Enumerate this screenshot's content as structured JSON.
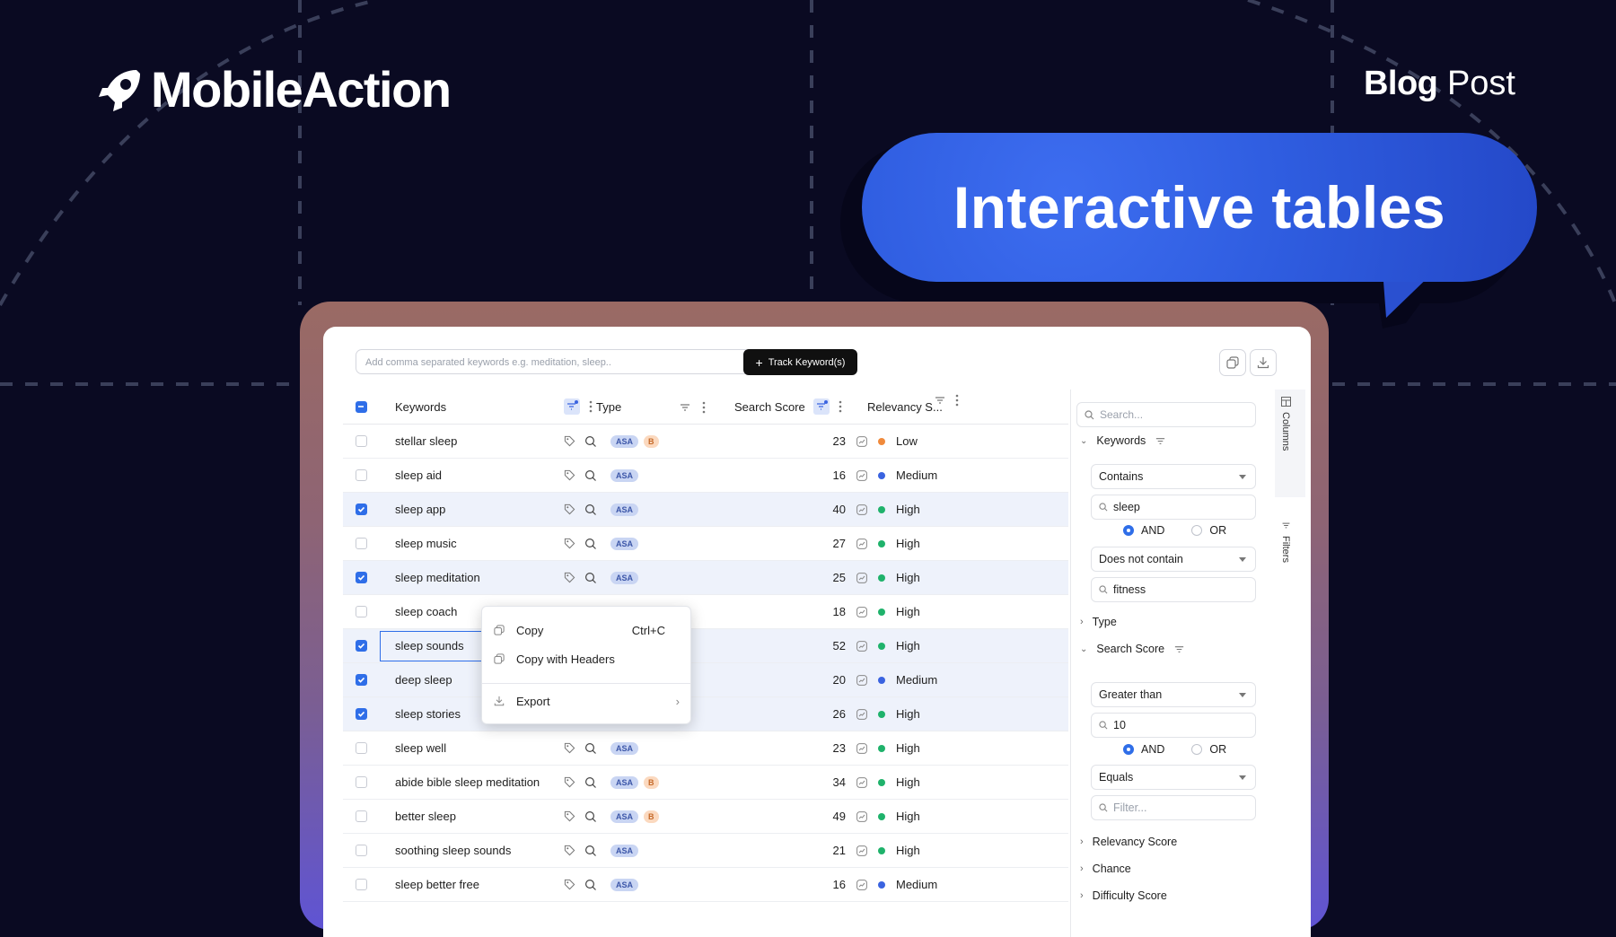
{
  "brand": {
    "name": "MobileAction"
  },
  "blog_tag": {
    "bold": "Blog",
    "regular": "Post"
  },
  "headline": "Interactive tables",
  "toolbar": {
    "keyword_placeholder": "Add comma separated keywords e.g. meditation, sleep..",
    "track_label": "Track Keyword(s)"
  },
  "table": {
    "headers": {
      "keywords": "Keywords",
      "type": "Type",
      "search_score": "Search Score",
      "relevancy": "Relevancy S..."
    },
    "rows": [
      {
        "keyword": "stellar sleep",
        "b": true,
        "score": "23",
        "rel": "Low",
        "rel_color": "#f08a3c",
        "checked": false
      },
      {
        "keyword": "sleep aid",
        "b": false,
        "score": "16",
        "rel": "Medium",
        "rel_color": "#3a63e0",
        "checked": false
      },
      {
        "keyword": "sleep app",
        "b": false,
        "score": "40",
        "rel": "High",
        "rel_color": "#1fb26b",
        "checked": true
      },
      {
        "keyword": "sleep music",
        "b": false,
        "score": "27",
        "rel": "High",
        "rel_color": "#1fb26b",
        "checked": false
      },
      {
        "keyword": "sleep meditation",
        "b": false,
        "score": "25",
        "rel": "High",
        "rel_color": "#1fb26b",
        "checked": true
      },
      {
        "keyword": "sleep coach",
        "b": true,
        "score": "18",
        "rel": "High",
        "rel_color": "#1fb26b",
        "checked": false
      },
      {
        "keyword": "sleep sounds",
        "b": false,
        "score": "52",
        "rel": "High",
        "rel_color": "#1fb26b",
        "checked": true
      },
      {
        "keyword": "deep sleep",
        "b": false,
        "score": "20",
        "rel": "Medium",
        "rel_color": "#3a63e0",
        "checked": true
      },
      {
        "keyword": "sleep stories",
        "b": false,
        "score": "26",
        "rel": "High",
        "rel_color": "#1fb26b",
        "checked": true
      },
      {
        "keyword": "sleep well",
        "b": false,
        "score": "23",
        "rel": "High",
        "rel_color": "#1fb26b",
        "checked": false
      },
      {
        "keyword": "abide bible sleep meditation",
        "b": true,
        "score": "34",
        "rel": "High",
        "rel_color": "#1fb26b",
        "checked": false
      },
      {
        "keyword": "better sleep",
        "b": true,
        "score": "49",
        "rel": "High",
        "rel_color": "#1fb26b",
        "checked": false
      },
      {
        "keyword": "soothing sleep sounds",
        "b": false,
        "score": "21",
        "rel": "High",
        "rel_color": "#1fb26b",
        "checked": false
      },
      {
        "keyword": "sleep better free",
        "b": false,
        "score": "16",
        "rel": "Medium",
        "rel_color": "#3a63e0",
        "checked": false
      }
    ],
    "badge_asa": "ASA",
    "badge_b": "B"
  },
  "context_menu": {
    "copy": "Copy",
    "copy_shortcut": "Ctrl+C",
    "copy_headers": "Copy with Headers",
    "export": "Export"
  },
  "filters": {
    "search_placeholder": "Search...",
    "keywords_label": "Keywords",
    "cond1": "Contains",
    "val1": "sleep",
    "and": "AND",
    "or": "OR",
    "cond2": "Does not contain",
    "val2": "fitness",
    "type_label": "Type",
    "search_score_label": "Search Score",
    "cond3": "Greater than",
    "val3": "10",
    "cond4": "Equals",
    "filter_placeholder": "Filter...",
    "relevancy_label": "Relevancy Score",
    "chance_label": "Chance",
    "difficulty_label": "Difficulty Score"
  },
  "side_tabs": {
    "columns": "Columns",
    "filters": "Filters"
  }
}
